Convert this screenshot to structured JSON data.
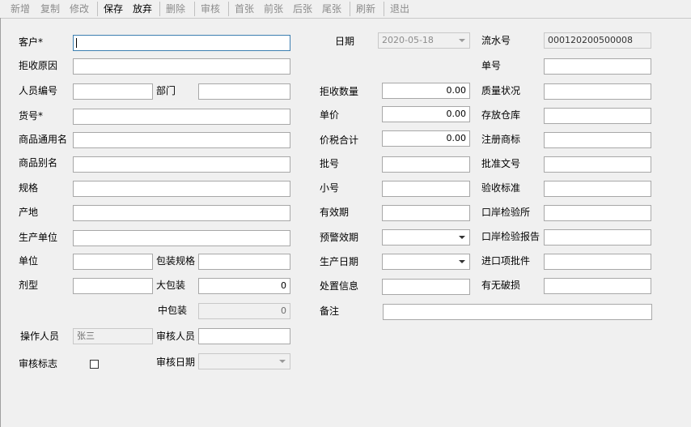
{
  "toolbar": {
    "new": "新增",
    "copy": "复制",
    "edit": "修改",
    "save": "保存",
    "cancel": "放弃",
    "delete": "删除",
    "audit": "审核",
    "first": "首张",
    "prev": "前张",
    "next": "后张",
    "last": "尾张",
    "refresh": "刷新",
    "exit": "退出"
  },
  "labels": {
    "customer": "客户*",
    "reject_reason": "拒收原因",
    "staff_code": "人员编号",
    "department": "部门",
    "item_no": "货号*",
    "generic_name": "商品通用名",
    "alias_name": "商品别名",
    "spec": "规格",
    "origin": "产地",
    "manufacturer": "生产单位",
    "unit": "单位",
    "package_spec": "包装规格",
    "dosage_form": "剂型",
    "big_package": "大包装",
    "mid_package": "中包装",
    "operator": "操作人员",
    "auditor": "审核人员",
    "audit_flag": "审核标志",
    "audit_date": "审核日期",
    "date": "日期",
    "reject_qty": "拒收数量",
    "unit_price": "单价",
    "tax_total": "价税合计",
    "batch_no": "批号",
    "small_no": "小号",
    "valid_period": "有效期",
    "warning_period": "预警效期",
    "production_date": "生产日期",
    "disposal_info": "处置信息",
    "remark": "备注",
    "serial_no": "流水号",
    "doc_no": "单号",
    "quality": "质量状况",
    "storage": "存放仓库",
    "trademark": "注册商标",
    "approval_no": "批准文号",
    "acceptance_std": "验收标准",
    "port_inspection": "口岸检验所",
    "port_report": "口岸检验报告",
    "import_batch": "进口项批件",
    "damaged": "有无破损"
  },
  "values": {
    "date": "2020-05-18",
    "serial_no": "000120200500008",
    "reject_qty": "0.00",
    "unit_price": "0.00",
    "tax_total": "0.00",
    "big_package": "0",
    "mid_package": "0",
    "operator": "张三"
  }
}
